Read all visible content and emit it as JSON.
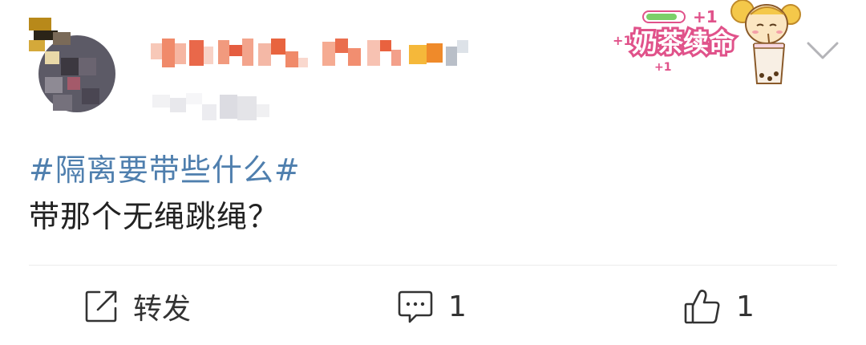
{
  "post": {
    "hashtag": "#隔离要带些什么#",
    "text": "带那个无绳跳绳？"
  },
  "badge": {
    "text": "奶茶续命",
    "plus_one": "+1"
  },
  "actions": {
    "repost_label": "转发",
    "comment_count": "1",
    "like_count": "1"
  },
  "colors": {
    "hashtag": "#4f7fae",
    "text": "#222222",
    "divider": "#ececec",
    "badge_pink": "#e0528a"
  },
  "icons": {
    "repost": "share-square-icon",
    "comment": "comment-icon",
    "like": "thumbs-up-icon",
    "menu": "chevron-down-icon"
  }
}
